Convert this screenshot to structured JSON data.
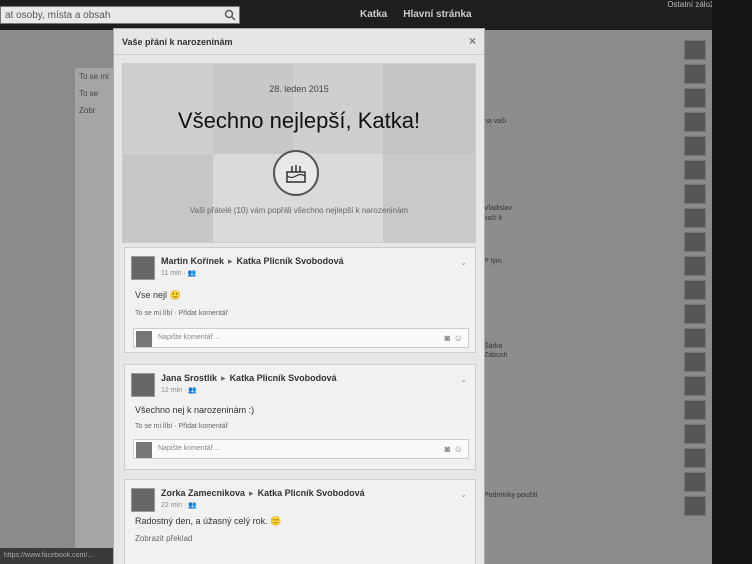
{
  "top": {
    "search_placeholder": "at osoby, místa a obsah",
    "nav_user": "Katka",
    "nav_home": "Hlavní stránka",
    "browser_right": "Ostatní záložky"
  },
  "background": {
    "left_items": [
      "To se mi",
      "To se",
      "Zobr"
    ],
    "right_texts": [
      "na vaši",
      "Vladislav",
      "kačí k",
      "P tým",
      "Šárka",
      "Zábosh",
      "Podmínky použití"
    ],
    "status_url": "https://www.facebook.com/..."
  },
  "dialog": {
    "title": "Vaše přání k narozeninám",
    "close": "×",
    "banner": {
      "date": "28. leden 2015",
      "headline": "Všechno nejlepší, Katka!",
      "subtitle": "Vaši přátelé (10) vám popřáli všechno nejlepší k narozeninám"
    },
    "posts": [
      {
        "author": "Martin Kořínek",
        "target": "Katka Plicník Svobodová",
        "time": "11 min",
        "message": "Vse nejl 🙂",
        "like": "To se mi líbí",
        "comment_action": "Přidat komentář",
        "comment_placeholder": "Napište komentář…"
      },
      {
        "author": "Jana Srostlík",
        "target": "Katka Plicník Svobodová",
        "time": "12 min",
        "message": "Všechno nej k narozeninám :)",
        "like": "To se mi líbí",
        "comment_action": "Přidat komentář",
        "comment_placeholder": "Napište komentář…"
      },
      {
        "author": "Zorka Zamecnikova",
        "target": "Katka Plicník Svobodová",
        "time": "22 min",
        "message": "Radostný den, a úžasný celý rok. 🙂",
        "translate": "Zobrazit překlad"
      }
    ]
  }
}
